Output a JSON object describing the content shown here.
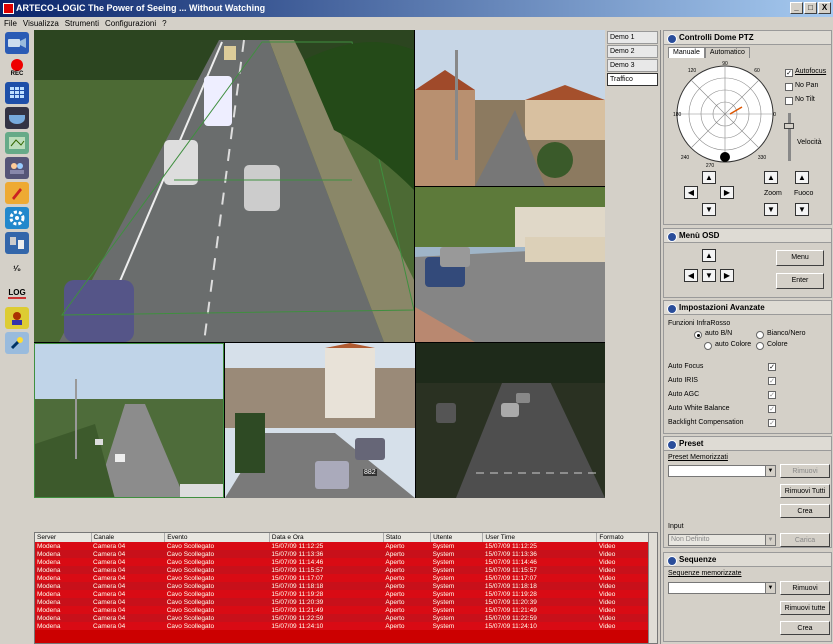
{
  "window": {
    "title": "ARTECO-LOGIC  The Power of Seeing ... Without Watching",
    "controls": [
      "_",
      "□",
      "X"
    ]
  },
  "menu": [
    "File",
    "Visualizza",
    "Strumenti",
    "Configurazioni",
    "?"
  ],
  "toolbar": {
    "rec_label": "REC",
    "log_label": "LOG"
  },
  "presets": [
    "Demo 1",
    "Demo 2",
    "Demo 3",
    "Traffico"
  ],
  "osd_text": "882",
  "events": {
    "columns": [
      "Server",
      "Canale",
      "Evento",
      "Data e Ora",
      "Stato",
      "Utente",
      "User Time",
      "Formato"
    ],
    "rows": [
      [
        "Modena",
        "Camera 04",
        "Cavo Scollegato",
        "15/07/09 11:12:25",
        "Aperto",
        "System",
        "15/07/09 11:12:25",
        "Video"
      ],
      [
        "Modena",
        "Camera 04",
        "Cavo Scollegato",
        "15/07/09 11:13:36",
        "Aperto",
        "System",
        "15/07/09 11:13:36",
        "Video"
      ],
      [
        "Modena",
        "Camera 04",
        "Cavo Scollegato",
        "15/07/09 11:14:46",
        "Aperto",
        "System",
        "15/07/09 11:14:46",
        "Video"
      ],
      [
        "Modena",
        "Camera 04",
        "Cavo Scollegato",
        "15/07/09 11:15:57",
        "Aperto",
        "System",
        "15/07/09 11:15:57",
        "Video"
      ],
      [
        "Modena",
        "Camera 04",
        "Cavo Scollegato",
        "15/07/09 11:17:07",
        "Aperto",
        "System",
        "15/07/09 11:17:07",
        "Video"
      ],
      [
        "Modena",
        "Camera 04",
        "Cavo Scollegato",
        "15/07/09 11:18:18",
        "Aperto",
        "System",
        "15/07/09 11:18:18",
        "Video"
      ],
      [
        "Modena",
        "Camera 04",
        "Cavo Scollegato",
        "15/07/09 11:19:28",
        "Aperto",
        "System",
        "15/07/09 11:19:28",
        "Video"
      ],
      [
        "Modena",
        "Camera 04",
        "Cavo Scollegato",
        "15/07/09 11:20:39",
        "Aperto",
        "System",
        "15/07/09 11:20:39",
        "Video"
      ],
      [
        "Modena",
        "Camera 04",
        "Cavo Scollegato",
        "15/07/09 11:21:49",
        "Aperto",
        "System",
        "15/07/09 11:21:49",
        "Video"
      ],
      [
        "Modena",
        "Camera 04",
        "Cavo Scollegato",
        "15/07/09 11:22:59",
        "Aperto",
        "System",
        "15/07/09 11:22:59",
        "Video"
      ],
      [
        "Modena",
        "Camera 04",
        "Cavo Scollegato",
        "15/07/09 11:24:10",
        "Aperto",
        "System",
        "15/07/09 11:24:10",
        "Video"
      ]
    ]
  },
  "ptz": {
    "title": "Controlli Dome PTZ",
    "tabs": [
      "Manuale",
      "Automatico"
    ],
    "dial_labels": {
      "n": "90",
      "ne": "60",
      "e": "0",
      "se": "330",
      "s": "270",
      "sw": "240",
      "w": "180",
      "nw": "120",
      "low": "210",
      "low2": "300",
      "nnw": "150",
      "nne": "30"
    },
    "checks": [
      {
        "label": "Autofocus",
        "checked": true
      },
      {
        "label": "No Pan",
        "checked": false
      },
      {
        "label": "No Tilt",
        "checked": false
      }
    ],
    "velocita": "Velocità",
    "zoom": "Zoom",
    "fuoco": "Fuoco"
  },
  "osd": {
    "title": "Menù OSD",
    "menu_btn": "Menu",
    "enter_btn": "Enter"
  },
  "advanced": {
    "title": "Impostazioni Avanzate",
    "infrarosso_label": "Funzioni InfraRosso",
    "radios": [
      {
        "label": "auto B/N",
        "on": true
      },
      {
        "label": "Bianco/Nero",
        "on": false
      },
      {
        "label": "auto Colore",
        "on": false
      },
      {
        "label": "Colore",
        "on": false
      }
    ],
    "checks": [
      {
        "label": "Auto Focus",
        "checked": true
      },
      {
        "label": "Auto IRIS",
        "checked": true
      },
      {
        "label": "Auto AGC",
        "checked": true
      },
      {
        "label": "Auto White Balance",
        "checked": true
      },
      {
        "label": "Backlight Compensation",
        "checked": true
      }
    ]
  },
  "preset": {
    "title": "Preset",
    "memorizzati_label": "Preset Memorizzati",
    "rimuovi": "Rimuovi",
    "rimuovi_tutti": "Rimuovi Tutti",
    "crea": "Crea",
    "input_label": "Input",
    "input_value": "Non Definito",
    "carica": "Carica"
  },
  "sequenze": {
    "title": "Sequenze",
    "memorizzate_label": "Sequenze memorizzate",
    "rimuovi": "Rimuovi",
    "rimuovi_tutte": "Rimuovi tutte",
    "crea": "Crea"
  },
  "colors": {
    "alarm_red": "#d90b14",
    "title_blue": "#0a246a",
    "detection_green": "#3f8f3f"
  }
}
